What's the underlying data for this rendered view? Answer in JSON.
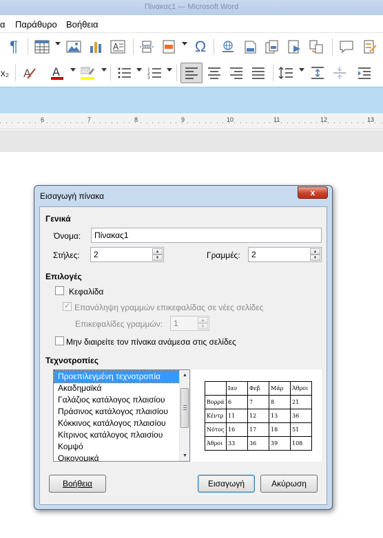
{
  "window": {
    "title": "Πίνακας1 — Microsoft Word"
  },
  "menu": {
    "items": [
      "α",
      "Παράθυρο",
      "Βοήθεια"
    ]
  },
  "toolbar1": {
    "icons": [
      "pilcrow-icon",
      "table-icon",
      "image-icon",
      "chart-icon",
      "text-box-icon",
      "page-break-icon",
      "field-icon",
      "special-character-icon",
      "hyperlink-icon",
      "footnote-icon",
      "endnote-icon",
      "bookmark-icon",
      "cross-reference-icon",
      "comment-icon",
      "track-changes-icon"
    ]
  },
  "toolbar2": {
    "subscript_glyph": "x₂",
    "icons": [
      "subscript-icon",
      "clear-formatting-icon",
      "font-color-icon",
      "highlight-icon",
      "bullets-icon",
      "numbering-icon",
      "align-left-icon",
      "align-center-icon",
      "align-right-icon",
      "justify-icon",
      "line-spacing-icon",
      "paragraph-spacing-increase-icon",
      "paragraph-spacing-decrease-icon"
    ]
  },
  "ruler": {
    "marks": [
      "6",
      "7",
      "8",
      "9",
      "10",
      "11",
      "12",
      "13"
    ]
  },
  "dialog": {
    "title": "Εισαγωγή πίνακα",
    "close_label": "x",
    "general": {
      "heading": "Γενικά",
      "name_label": "Όνομα:",
      "name_value": "Πίνακας1",
      "columns_label": "Στήλες:",
      "columns_value": "2",
      "rows_label": "Γραμμές:",
      "rows_value": "2"
    },
    "options": {
      "heading": "Επιλογές",
      "heading_label": "Κεφαλίδα",
      "heading_checked": false,
      "repeat_label": "Επανάληψη γραμμών επικεφαλίδας σε νέες σελίδες",
      "repeat_checked": true,
      "heading_rows_label": "Επικεφαλίδες γραμμών:",
      "heading_rows_value": "1",
      "no_split_label": "Μην διαιρείτε τον πίνακα ανάμεσα στις σελίδες",
      "no_split_checked": false
    },
    "styles": {
      "heading": "Τεχνοτροπίες",
      "items": [
        "Προεπιλεγμένη τεχνοτροπία",
        "Ακαδημαϊκά",
        "Γαλάζιος κατάλογος πλαισίου",
        "Πράσινος κατάλογος πλαισίου",
        "Κόκκινος κατάλογος πλαισίου",
        "Κίτρινος κατάλογος πλαισίου",
        "Κομψό",
        "Οικονομικά"
      ],
      "selected": "Προεπιλεγμένη τεχνοτροπία"
    },
    "preview": {
      "rows": [
        [
          "",
          "Ιαν",
          "Φεβ",
          "Μάρ",
          "Άθροι"
        ],
        [
          "Βορρά",
          "6",
          "7",
          "8",
          "21"
        ],
        [
          "Κέντρ",
          "11",
          "12",
          "13",
          "36"
        ],
        [
          "Νότος",
          "16",
          "17",
          "18",
          "51"
        ],
        [
          "Άθροι",
          "33",
          "36",
          "39",
          "108"
        ]
      ]
    },
    "buttons": {
      "help": "Βοήθεια",
      "insert": "Εισαγωγή",
      "cancel": "Ακύρωση"
    }
  },
  "colors": {
    "accent": "#3399ff",
    "ribbon": "#b9dcf3",
    "dialog_frame": "#c8daee",
    "close": "#c9412a"
  }
}
